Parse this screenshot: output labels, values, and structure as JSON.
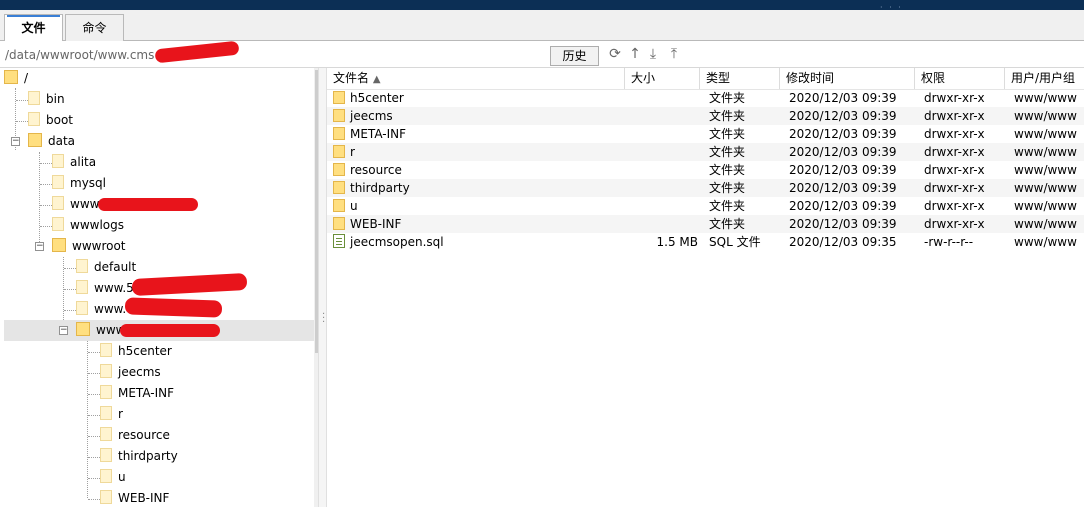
{
  "tabs": [
    {
      "label": "文件",
      "active": true
    },
    {
      "label": "命令",
      "active": false
    }
  ],
  "pathbar": {
    "path": "/data/wwwroot/www.cms",
    "history_label": "历史",
    "icons": [
      "refresh-icon",
      "up-arrow-icon",
      "download-icon",
      "upload-icon"
    ]
  },
  "tree": {
    "root": "/",
    "items": [
      {
        "label": "bin"
      },
      {
        "label": "boot"
      },
      {
        "label": "data"
      },
      {
        "label": "alita"
      },
      {
        "label": "mysql"
      },
      {
        "label": "www."
      },
      {
        "label": "wwwlogs"
      },
      {
        "label": "wwwroot"
      },
      {
        "label": "default"
      },
      {
        "label": "www.5"
      },
      {
        "label": "www."
      },
      {
        "label": "www."
      },
      {
        "label": "h5center"
      },
      {
        "label": "jeecms"
      },
      {
        "label": "META-INF"
      },
      {
        "label": "r"
      },
      {
        "label": "resource"
      },
      {
        "label": "thirdparty"
      },
      {
        "label": "u"
      },
      {
        "label": "WEB-INF"
      }
    ]
  },
  "table": {
    "columns": [
      "文件名",
      "大小",
      "类型",
      "修改时间",
      "权限",
      "用户/用户组"
    ],
    "rows": [
      {
        "name": "h5center",
        "size": "",
        "type": "文件夹",
        "mtime": "2020/12/03 09:39",
        "perm": "drwxr-xr-x",
        "owner": "www/www",
        "icon": "folder-icon"
      },
      {
        "name": "jeecms",
        "size": "",
        "type": "文件夹",
        "mtime": "2020/12/03 09:39",
        "perm": "drwxr-xr-x",
        "owner": "www/www",
        "icon": "folder-icon"
      },
      {
        "name": "META-INF",
        "size": "",
        "type": "文件夹",
        "mtime": "2020/12/03 09:39",
        "perm": "drwxr-xr-x",
        "owner": "www/www",
        "icon": "folder-icon"
      },
      {
        "name": "r",
        "size": "",
        "type": "文件夹",
        "mtime": "2020/12/03 09:39",
        "perm": "drwxr-xr-x",
        "owner": "www/www",
        "icon": "folder-icon"
      },
      {
        "name": "resource",
        "size": "",
        "type": "文件夹",
        "mtime": "2020/12/03 09:39",
        "perm": "drwxr-xr-x",
        "owner": "www/www",
        "icon": "folder-icon"
      },
      {
        "name": "thirdparty",
        "size": "",
        "type": "文件夹",
        "mtime": "2020/12/03 09:39",
        "perm": "drwxr-xr-x",
        "owner": "www/www",
        "icon": "folder-icon"
      },
      {
        "name": "u",
        "size": "",
        "type": "文件夹",
        "mtime": "2020/12/03 09:39",
        "perm": "drwxr-xr-x",
        "owner": "www/www",
        "icon": "folder-icon"
      },
      {
        "name": "WEB-INF",
        "size": "",
        "type": "文件夹",
        "mtime": "2020/12/03 09:39",
        "perm": "drwxr-xr-x",
        "owner": "www/www",
        "icon": "folder-icon"
      },
      {
        "name": "jeecmsopen.sql",
        "size": "1.5 MB",
        "type": "SQL 文件",
        "mtime": "2020/12/03 09:35",
        "perm": "-rw-r--r--",
        "owner": "www/www",
        "icon": "sql-file-icon"
      }
    ]
  },
  "colors": {
    "redaction": "#e8141b",
    "titlebar": "#0c2f55",
    "selection": "#e5e5e5"
  }
}
